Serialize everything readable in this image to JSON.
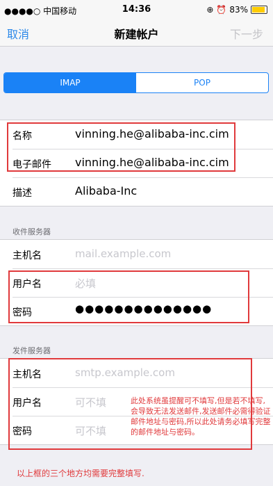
{
  "status_bar": {
    "carrier": "●●●●○ 中国移动",
    "wifi_icon": "wifi-icon",
    "time": "14:36",
    "battery_percent": "83%",
    "battery_level": 0.83,
    "battery_color": "#ffcc00"
  },
  "nav": {
    "cancel": "取消",
    "title": "新建帐户",
    "next": "下一步"
  },
  "colors": {
    "accent": "#1a82f6",
    "annotation_red": "#e0393b"
  },
  "protocol": {
    "options": [
      "IMAP",
      "POP"
    ],
    "selected": "IMAP"
  },
  "account": {
    "name_label": "名称",
    "name_value": "vinning.he@alibaba-inc.cim",
    "email_label": "电子邮件",
    "email_value": "vinning.he@alibaba-inc.cim",
    "desc_label": "描述",
    "desc_value": "Alibaba-Inc"
  },
  "incoming": {
    "header": "收件服务器",
    "host_label": "主机名",
    "host_placeholder": "mail.example.com",
    "user_label": "用户名",
    "user_placeholder": "必填",
    "pass_label": "密码",
    "pass_value": "●●●●●●●●●●●●●●"
  },
  "outgoing": {
    "header": "发件服务器",
    "host_label": "主机名",
    "host_placeholder": "smtp.example.com",
    "user_label": "用户名",
    "user_placeholder": "可不填",
    "pass_label": "密码",
    "pass_placeholder": "可不填"
  },
  "annotations": {
    "side_note": "此处系统虽提醒可不填写,但是若不填写,会导致无法发送邮件,发送邮件必需得验证邮件地址与密码,所以此处请务必填写完整的邮件地址与密码。",
    "bottom_note": "以上框的三个地方均需要完整填写."
  }
}
